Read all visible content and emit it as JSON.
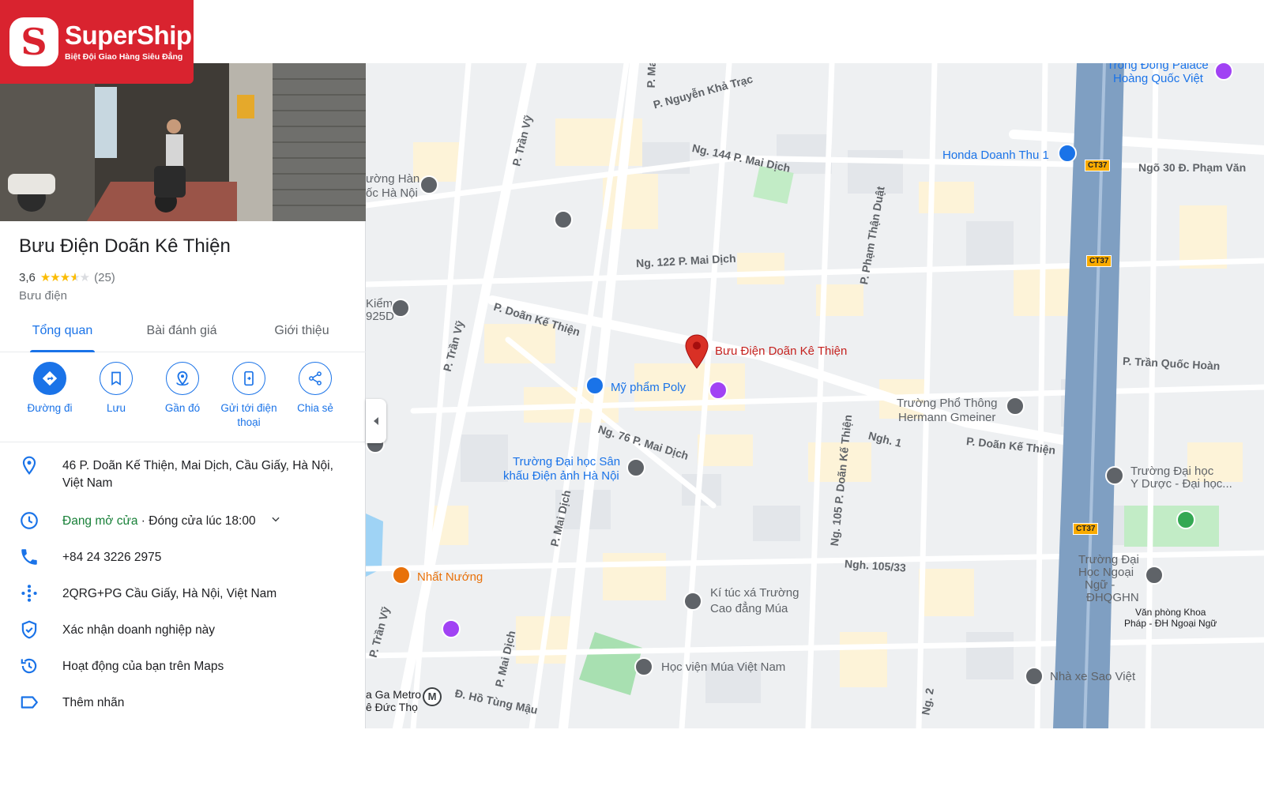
{
  "brand": {
    "name": "SuperShip",
    "tagline": "Biệt Đội Giao Hàng Siêu Đẳng",
    "mark": "S",
    "color": "#d9232f"
  },
  "place": {
    "title": "Bưu Điện Doãn Kê Thiện",
    "rating_value": "3,6",
    "rating": 3.6,
    "review_count": "(25)",
    "category": "Bưu điện"
  },
  "tabs": [
    {
      "label": "Tổng quan",
      "active": true
    },
    {
      "label": "Bài đánh giá",
      "active": false
    },
    {
      "label": "Giới thiệu",
      "active": false
    }
  ],
  "actions": [
    {
      "label": "Đường đi",
      "icon": "directions-icon"
    },
    {
      "label": "Lưu",
      "icon": "bookmark-icon"
    },
    {
      "label": "Gần đó",
      "icon": "nearby-icon"
    },
    {
      "label": "Gửi tới điện thoại",
      "icon": "send-to-phone-icon"
    },
    {
      "label": "Chia sẻ",
      "icon": "share-icon"
    }
  ],
  "info": {
    "address": "46 P. Doãn Kế Thiện, Mai Dịch, Cầu Giấy, Hà Nội, Việt Nam",
    "hours_status": "Đang mở cửa",
    "hours_close": " · Đóng cửa lúc 18:00",
    "phone": "+84 24 3226 2975",
    "plus_code": "2QRG+PG Cầu Giấy, Hà Nội, Việt Nam",
    "claim": "Xác nhận doanh nghiệp này",
    "activity": "Hoạt động của bạn trên Maps",
    "label": "Thêm nhãn"
  },
  "colors": {
    "accent": "#1a73e8",
    "open": "#188038",
    "pin": "#d93025",
    "road_highway": "#8ab4f8",
    "block_yellow": "#fdf3d8"
  },
  "map": {
    "roads": [
      {
        "text": "P. Nguyễn Khả Trạc"
      },
      {
        "text": "Ng. 144 P. Mai Dịch"
      },
      {
        "text": "P. Trần Vỹ"
      },
      {
        "text": "Ng. 122 P. Mai Dịch"
      },
      {
        "text": "P. Phạm Thận Duật"
      },
      {
        "text": "P. Doãn Kế Thiện"
      },
      {
        "text": "P. Trần Vỹ"
      },
      {
        "text": "Ng. 76 P. Mai Dịch"
      },
      {
        "text": "P. Mai Dịch"
      },
      {
        "text": "Ng. 105 P. Doãn Kế Thiện"
      },
      {
        "text": "Ngh. 1"
      },
      {
        "text": "P. Doãn Kế Thiện"
      },
      {
        "text": "Ngh. 105/33"
      },
      {
        "text": "P. Trần Vỹ"
      },
      {
        "text": "P. Mai Dịch"
      },
      {
        "text": "Đ. Hồ Tùng Mậu"
      },
      {
        "text": "Ng. 2"
      },
      {
        "text": "P. Trần Quốc Hoàn"
      },
      {
        "text": "Ngõ 30 Đ. Phạm Văn"
      },
      {
        "text": "P. Ma"
      }
    ],
    "pois": [
      {
        "text": "Bưu Điện Doãn Kê Thiện",
        "color": "#c5221f"
      },
      {
        "text": "Mỹ phẩm Poly",
        "color": "#1a73e8"
      },
      {
        "text": "Honda Doanh Thu 1",
        "color": "#1a73e8"
      },
      {
        "text": "Trường Phổ Thông",
        "color": "#5f6368"
      },
      {
        "text": "Hermann Gmeiner",
        "color": "#5f6368"
      },
      {
        "text": "Trường Đại học Sân",
        "color": "#1a73e8"
      },
      {
        "text": "khấu Điện ảnh Hà Nội",
        "color": "#1a73e8"
      },
      {
        "text": "Nhất Nướng",
        "color": "#e8710a"
      },
      {
        "text": "Kí túc xá Trường",
        "color": "#5f6368"
      },
      {
        "text": "Cao đẳng Múa",
        "color": "#5f6368"
      },
      {
        "text": "Học viện Múa Việt Nam",
        "color": "#5f6368"
      },
      {
        "text": "Nhà xe Sao Việt",
        "color": "#5f6368"
      },
      {
        "text": "Trường Đại học",
        "color": "#5f6368"
      },
      {
        "text": "Y Dược - Đại học...",
        "color": "#5f6368"
      },
      {
        "text": "Trường Đại",
        "color": "#5f6368"
      },
      {
        "text": "Học Ngoại",
        "color": "#5f6368"
      },
      {
        "text": "Ngữ -",
        "color": "#5f6368"
      },
      {
        "text": "ĐHQGHN",
        "color": "#5f6368"
      },
      {
        "text": "Văn phòng Khoa",
        "color": "#202124"
      },
      {
        "text": "Pháp - ĐH Ngoại Ngữ",
        "color": "#202124"
      },
      {
        "text": "Trống Đồng Palace",
        "color": "#1a73e8"
      },
      {
        "text": "Hoàng Quốc Việt",
        "color": "#1a73e8"
      },
      {
        "text": "ường Hàn",
        "color": "#5f6368"
      },
      {
        "text": "ốc Hà Nội",
        "color": "#5f6368"
      },
      {
        "text": "Kiểm",
        "color": "#5f6368"
      },
      {
        "text": "925D",
        "color": "#5f6368"
      },
      {
        "text": "a Ga Metro",
        "color": "#202124"
      },
      {
        "text": "ê Đức Thọ",
        "color": "#202124"
      }
    ],
    "shields": [
      "CT37",
      "CT37",
      "CT37"
    ]
  }
}
